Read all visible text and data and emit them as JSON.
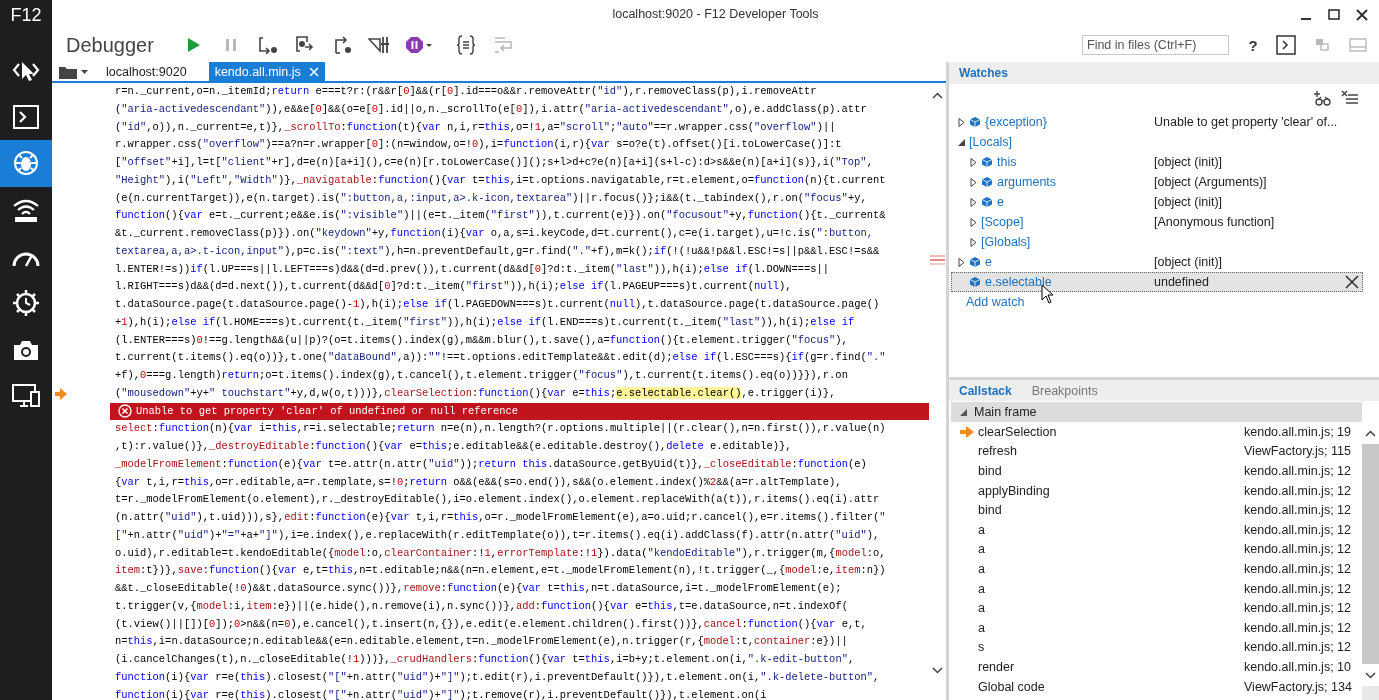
{
  "window": {
    "title": "localhost:9020 - F12 Developer Tools"
  },
  "sidebar": {
    "label": "F12",
    "tools": [
      {
        "kind": "dom",
        "selected": false
      },
      {
        "kind": "console",
        "selected": false
      },
      {
        "kind": "debugger",
        "selected": true
      },
      {
        "kind": "network",
        "selected": false
      },
      {
        "kind": "performance",
        "selected": false
      },
      {
        "kind": "memory",
        "selected": false
      },
      {
        "kind": "emulation",
        "selected": false
      },
      {
        "kind": "display",
        "selected": false
      }
    ]
  },
  "toolbar": {
    "title": "Debugger",
    "buttons": [
      {
        "kind": "continue",
        "disabled": false
      },
      {
        "kind": "break",
        "disabled": true
      },
      {
        "kind": "step-into",
        "disabled": false
      },
      {
        "kind": "step-over",
        "disabled": false
      },
      {
        "kind": "step-out",
        "disabled": false
      },
      {
        "kind": "break-worker",
        "disabled": false
      },
      {
        "kind": "exceptions",
        "disabled": false
      },
      {
        "kind": "pretty-print",
        "disabled": false
      },
      {
        "kind": "word-wrap",
        "disabled": true
      }
    ],
    "search": {
      "placeholder": "Find in files (Ctrl+F)"
    },
    "right_buttons": [
      {
        "kind": "help",
        "label": "?",
        "disabled": false
      },
      {
        "kind": "console",
        "disabled": false
      },
      {
        "kind": "pin",
        "disabled": true
      },
      {
        "kind": "dock",
        "disabled": true
      }
    ]
  },
  "editor": {
    "tabs": [
      {
        "label": "localhost:9020",
        "selected": false
      },
      {
        "label": "kendo.all.min.js",
        "selected": true
      }
    ],
    "lines": [
      {
        "kind": "code",
        "text": "r=n._current,o=n._itemId;return e===t?r:(r&&r[0]&&(r[0].id===o&&r.removeAttr(\"id\"),r.removeClass(p),i.removeAttr"
      },
      {
        "kind": "code",
        "text": "(\"aria-activedescendant\")),e&&e[0]&&(o=e[0].id||o,n._scrollTo(e[0]),i.attr(\"aria-activedescendant\",o),e.addClass(p).attr"
      },
      {
        "kind": "code",
        "text": "(\"id\",o)),n._current=e,t)},_scrollTo:function(t){var n,i,r=this,o=!1,a=\"scroll\";\"auto\"==r.wrapper.css(\"overflow\")||"
      },
      {
        "kind": "code",
        "text": "r.wrapper.css(\"overflow\")==a?n=r.wrapper[0]:(n=window,o=!0),i=function(i,r){var s=o?e(t).offset()[i.toLowerCase()]:t"
      },
      {
        "kind": "code",
        "text": "[\"offset\"+i],l=t[\"client\"+r],d=e(n)[a+i](),c=e(n)[r.toLowerCase()]();s+l>d+c?e(n)[a+i](s+l-c):d>s&&e(n)[a+i](s)},i(\"Top\","
      },
      {
        "kind": "code",
        "text": "\"Height\"),i(\"Left\",\"Width\")},_navigatable:function(){var t=this,i=t.options.navigatable,r=t.element,o=function(n){t.current"
      },
      {
        "kind": "code",
        "text": "(e(n.currentTarget)),e(n.target).is(\":button,a,:input,a>.k-icon,textarea\")||r.focus()};i&&(t._tabindex(),r.on(\"focus\"+y,"
      },
      {
        "kind": "code",
        "text": "function(){var e=t._current;e&&e.is(\":visible\")||(e=t._item(\"first\")),t.current(e)}).on(\"focusout\"+y,function(){t._current&"
      },
      {
        "kind": "code",
        "text": "&t._current.removeClass(p)}).on(\"keydown\"+y,function(i){var o,a,s=i.keyCode,d=t.current(),c=e(i.target),u=!c.is(\":button,"
      },
      {
        "kind": "code",
        "text": "textarea,a,a>.t-icon,input\"),p=c.is(\":text\"),h=n.preventDefault,g=r.find(\".\"+f),m=k();if(!(!u&&!p&&l.ESC!=s||p&&l.ESC!=s&&"
      },
      {
        "kind": "code",
        "text": "l.ENTER!=s))if(l.UP===s||l.LEFT===s)d&&(d=d.prev()),t.current(d&&d[0]?d:t._item(\"last\")),h(i);else if(l.DOWN===s||"
      },
      {
        "kind": "code",
        "text": "l.RIGHT===s)d&&(d=d.next()),t.current(d&&d[0]?d:t._item(\"first\")),h(i);else if(l.PAGEUP===s)t.current(null),"
      },
      {
        "kind": "code",
        "text": "t.dataSource.page(t.dataSource.page()-1),h(i);else if(l.PAGEDOWN===s)t.current(null),t.dataSource.page(t.dataSource.page()"
      },
      {
        "kind": "code",
        "text": "+1),h(i);else if(l.HOME===s)t.current(t._item(\"first\")),h(i);else if(l.END===s)t.current(t._item(\"last\")),h(i);else if"
      },
      {
        "kind": "code",
        "text": "(l.ENTER===s)0!==g.length&&(u||p)?(o=t.items().index(g),m&&m.blur(),t.save(),a=function(){t.element.trigger(\"focus\"),"
      },
      {
        "kind": "code",
        "text": "t.current(t.items().eq(o))},t.one(\"dataBound\",a)):\"\"!==t.options.editTemplate&&t.edit(d);else if(l.ESC===s){if(g=r.find(\".\""
      },
      {
        "kind": "code",
        "text": "+f),0===g.length)return;o=t.items().index(g),t.cancel(),t.element.trigger(\"focus\"),t.current(t.items().eq(o))}}),r.on"
      },
      {
        "kind": "current",
        "text": "(\"mousedown\"+y+\" touchstart\"+y,d,w(o,t)))},clearSelection:function(){var e=this;",
        "highlight": "e.selectable.clear()",
        "after": ",e.trigger(i)},"
      },
      {
        "kind": "error",
        "text": "Unable to get property 'clear' of undefined or null reference"
      },
      {
        "kind": "code",
        "text": "select:function(n){var i=this,r=i.selectable;return n=e(n),n.length?(r.options.multiple||(r.clear(),n=n.first()),r.value(n)"
      },
      {
        "kind": "code",
        "text": ",t):r.value()},_destroyEditable:function(){var e=this;e.editable&&(e.editable.destroy(),delete e.editable)},"
      },
      {
        "kind": "code",
        "text": "_modelFromElement:function(e){var t=e.attr(n.attr(\"uid\"));return this.dataSource.getByUid(t)},_closeEditable:function(e)"
      },
      {
        "kind": "code",
        "text": "{var t,i,r=this,o=r.editable,a=r.template,s=!0;return o&&(e&&(s=o.end()),s&&(o.element.index()%2&&(a=r.altTemplate),"
      },
      {
        "kind": "code",
        "text": "t=r._modelFromElement(o.element),r._destroyEditable(),i=o.element.index(),o.element.replaceWith(a(t)),r.items().eq(i).attr"
      },
      {
        "kind": "code",
        "text": "(n.attr(\"uid\"),t.uid))),s},edit:function(e){var t,i,r=this,o=r._modelFromElement(e),a=o.uid;r.cancel(),e=r.items().filter(\""
      },
      {
        "kind": "code",
        "text": "[\"+n.attr(\"uid\")+\"=\"+a+\"]\"),i=e.index(),e.replaceWith(r.editTemplate(o)),t=r.items().eq(i).addClass(f).attr(n.attr(\"uid\"),"
      },
      {
        "kind": "code",
        "text": "o.uid),r.editable=t.kendoEditable({model:o,clearContainer:!1,errorTemplate:!1}).data(\"kendoEditable\"),r.trigger(m,{model:o,"
      },
      {
        "kind": "code",
        "text": "item:t})},save:function(){var e,t=this,n=t.editable;n&&(n=n.element,e=t._modelFromElement(n),!t.trigger(_,{model:e,item:n})"
      },
      {
        "kind": "code",
        "text": "&&t._closeEditable(!0)&&t.dataSource.sync())},remove:function(e){var t=this,n=t.dataSource,i=t._modelFromElement(e);"
      },
      {
        "kind": "code",
        "text": "t.trigger(v,{model:i,item:e})||(e.hide(),n.remove(i),n.sync())},add:function(){var e=this,t=e.dataSource,n=t.indexOf("
      },
      {
        "kind": "code",
        "text": "(t.view()||[])[0]);0>n&&(n=0),e.cancel(),t.insert(n,{}),e.edit(e.element.children().first())},cancel:function(){var e,t,"
      },
      {
        "kind": "code",
        "text": "n=this,i=n.dataSource;n.editable&&(e=n.editable.element,t=n._modelFromElement(e),n.trigger(r,{model:t,container:e})||"
      },
      {
        "kind": "code",
        "text": "(i.cancelChanges(t),n._closeEditable(!1)))},_crudHandlers:function(){var t=this,i=b+y;t.element.on(i,\".k-edit-button\","
      },
      {
        "kind": "code",
        "text": "function(i){var r=e(this).closest(\"[\"+n.attr(\"uid\")+\"]\");t.edit(r),i.preventDefault()}),t.element.on(i,\".k-delete-button\","
      },
      {
        "kind": "code",
        "text": "function(i){var r=e(this).closest(\"[\"+n.attr(\"uid\")+\"]\");t.remove(r),i.preventDefault()}),t.element.on(i"
      }
    ]
  },
  "watches": {
    "title": "Watches",
    "items": [
      {
        "name": "{exception}",
        "value": "Unable to get property 'clear' of...",
        "kind": "variable",
        "expandable": true,
        "expanded": false,
        "selected": false
      },
      {
        "name": "[Locals]",
        "kind": "group",
        "expandable": true,
        "expanded": true,
        "selected": false,
        "children": [
          {
            "name": "this",
            "value": "[object (init)]",
            "kind": "variable",
            "expandable": true,
            "expanded": false,
            "selected": false
          },
          {
            "name": "arguments",
            "value": "[object (Arguments)]",
            "kind": "variable",
            "expandable": true,
            "expanded": false,
            "selected": false
          },
          {
            "name": "e",
            "value": "[object (init)]",
            "kind": "variable",
            "expandable": true,
            "expanded": false,
            "selected": false
          },
          {
            "name": "[Scope]",
            "value": "[Anonymous function]",
            "kind": "group",
            "expandable": true,
            "expanded": false,
            "selected": false
          },
          {
            "name": "[Globals]",
            "kind": "group",
            "expandable": true,
            "expanded": false,
            "selected": false
          }
        ]
      },
      {
        "name": "e",
        "value": "[object (init)]",
        "kind": "variable",
        "expandable": true,
        "expanded": false,
        "selected": false
      },
      {
        "name": "e.selectable",
        "value": "undefined",
        "kind": "variable",
        "expandable": false,
        "selected": true
      }
    ],
    "add_link": "Add watch"
  },
  "callstack": {
    "tabs": [
      {
        "label": "Callstack",
        "selected": true
      },
      {
        "label": "Breakpoints",
        "selected": false
      }
    ],
    "groups": [
      {
        "name": "Main frame",
        "expanded": true,
        "frames": [
          {
            "function": "clearSelection",
            "location": "kendo.all.min.js; 19",
            "current": true
          },
          {
            "function": "refresh",
            "location": "ViewFactory.js; 115",
            "current": false
          },
          {
            "function": "bind",
            "location": "kendo.all.min.js; 12",
            "current": false
          },
          {
            "function": "applyBinding",
            "location": "kendo.all.min.js; 12",
            "current": false
          },
          {
            "function": "bind",
            "location": "kendo.all.min.js; 12",
            "current": false
          },
          {
            "function": "a",
            "location": "kendo.all.min.js; 12",
            "current": false
          },
          {
            "function": "a",
            "location": "kendo.all.min.js; 12",
            "current": false
          },
          {
            "function": "a",
            "location": "kendo.all.min.js; 12",
            "current": false
          },
          {
            "function": "a",
            "location": "kendo.all.min.js; 12",
            "current": false
          },
          {
            "function": "a",
            "location": "kendo.all.min.js; 12",
            "current": false
          },
          {
            "function": "a",
            "location": "kendo.all.min.js; 12",
            "current": false
          },
          {
            "function": "s",
            "location": "kendo.all.min.js; 12",
            "current": false
          },
          {
            "function": "render",
            "location": "kendo.all.min.js; 10",
            "current": false
          },
          {
            "function": "Global code",
            "location": "ViewFactory.js; 134",
            "current": false
          }
        ]
      }
    ]
  }
}
